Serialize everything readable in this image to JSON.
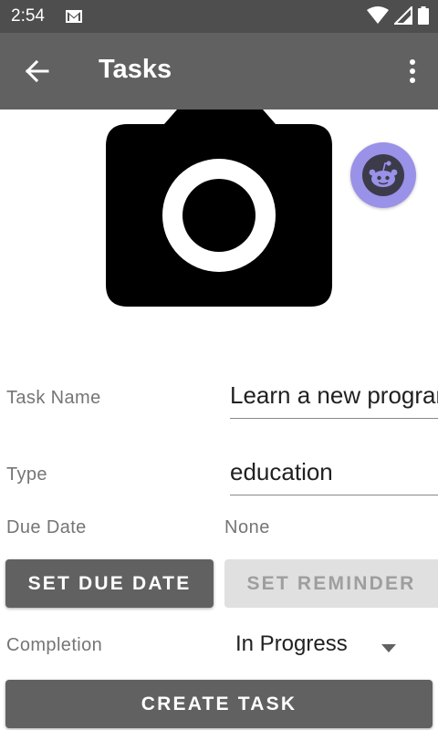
{
  "status_bar": {
    "time": "2:54"
  },
  "app_bar": {
    "title": "Tasks"
  },
  "form": {
    "task_name_label": "Task Name",
    "task_name_value": "Learn a new programming language",
    "type_label": "Type",
    "type_value": "education",
    "due_date_label": "Due Date",
    "due_date_value": "None",
    "set_due_date_button": "SET DUE DATE",
    "set_reminder_button": "SET REMINDER",
    "completion_label": "Completion",
    "completion_value": "In Progress",
    "create_task_button": "CREATE TASK"
  },
  "colors": {
    "status_bar": "#4e4e4e",
    "app_bar": "#616161",
    "fab": "#9a91e8",
    "button_dark": "#616161",
    "button_disabled": "#e0e0e0"
  }
}
